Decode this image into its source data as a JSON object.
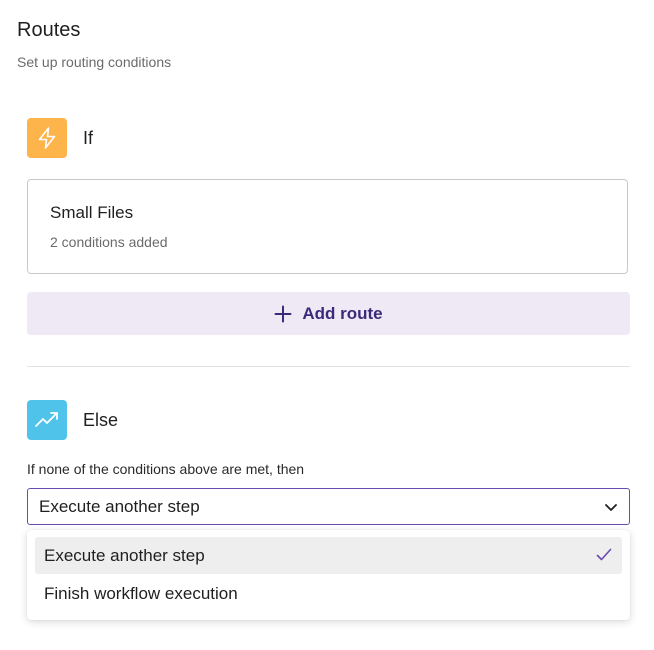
{
  "header": {
    "title": "Routes",
    "subtitle": "Set up routing conditions"
  },
  "if_section": {
    "label": "If",
    "icon": "lightning-icon",
    "icon_bg": "#fdb44b",
    "routes": [
      {
        "name": "Small Files",
        "meta": "2 conditions added"
      }
    ],
    "add_route_label": "Add route"
  },
  "else_section": {
    "label": "Else",
    "icon": "trending-up-icon",
    "icon_bg": "#4fc3ea",
    "description": "If none of the conditions above are met, then",
    "select_value": "Execute another step",
    "options": [
      {
        "label": "Execute another step",
        "selected": true
      },
      {
        "label": "Finish workflow execution",
        "selected": false
      }
    ]
  },
  "colors": {
    "accent": "#6a4bb0",
    "add_route_bg": "#efe9f6",
    "add_route_text": "#3a2a7a"
  }
}
